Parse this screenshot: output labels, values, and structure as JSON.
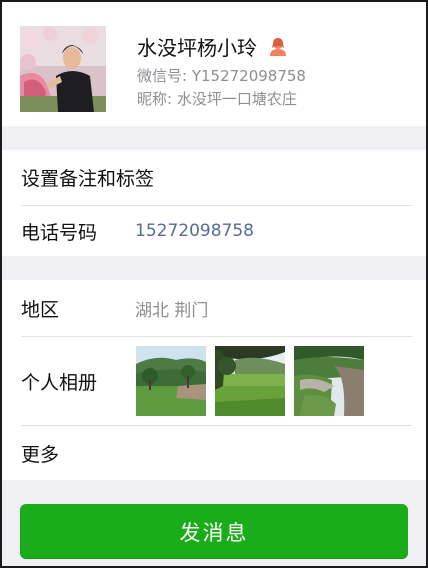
{
  "profile": {
    "name": "水没坪杨小玲",
    "wechat_id": "微信号: Y15272098758",
    "nickname": "昵称: 水没坪一口塘农庄",
    "gender_icon": "female-user-icon",
    "gender_color": "#f0825f"
  },
  "info": {
    "remark_label": "设置备注和标签",
    "phone_label": "电话号码",
    "phone_value": "15272098758",
    "region_label": "地区",
    "region_value": "湖北  荆门",
    "album_label": "个人相册",
    "more_label": "更多"
  },
  "actions": {
    "send_message": "发消息"
  },
  "colors": {
    "accent_green": "#1aad19",
    "link_blue": "#576b95",
    "background": "#efeff4"
  }
}
